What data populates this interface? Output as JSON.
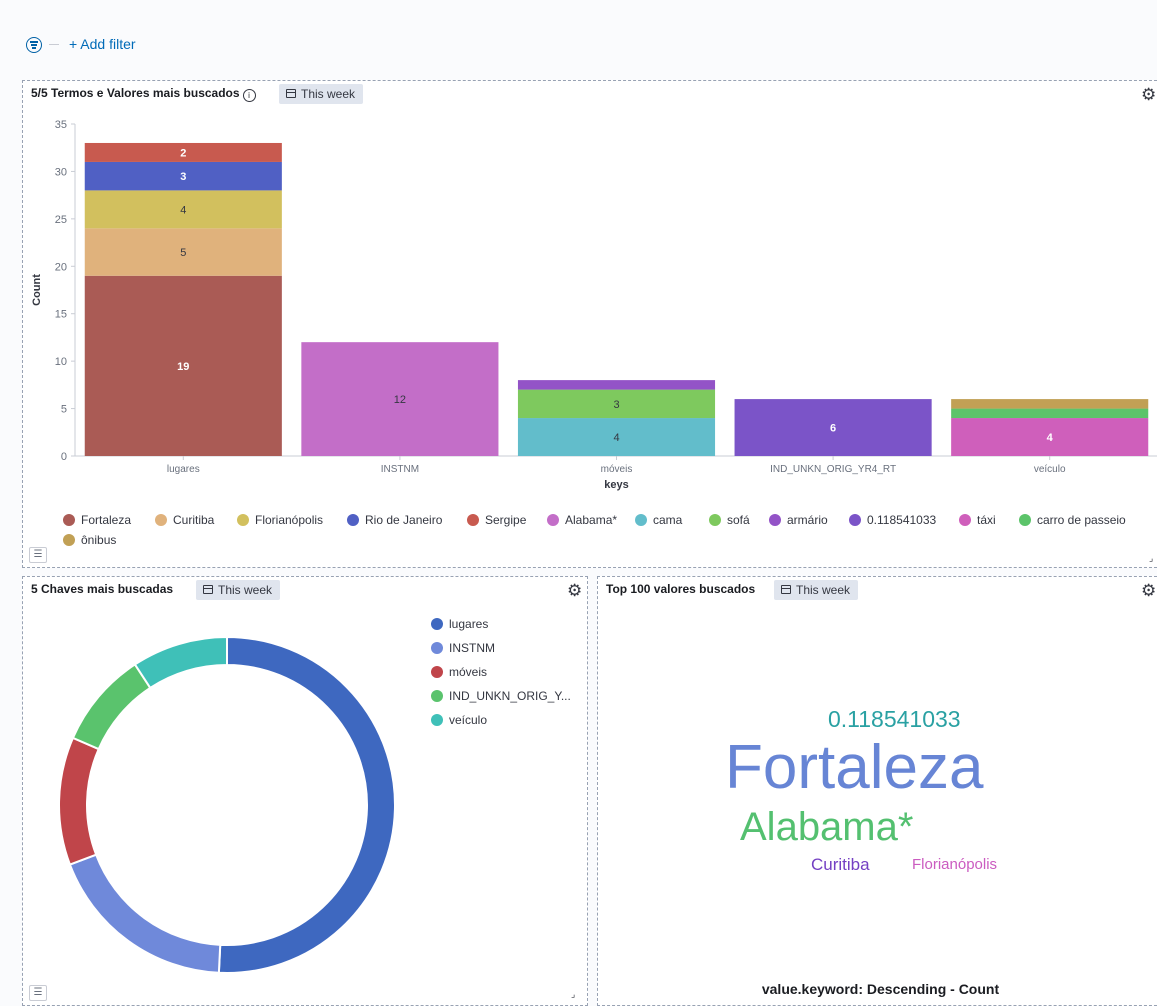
{
  "toolbar": {
    "add_filter": "+ Add filter"
  },
  "panel1": {
    "title": "5/5 Termos e Valores mais buscados",
    "badge": "This week",
    "legend": [
      {
        "label": "Fortaleza",
        "color": "#aa5b55"
      },
      {
        "label": "Curitiba",
        "color": "#e0b27c"
      },
      {
        "label": "Florianópolis",
        "color": "#d2c05e"
      },
      {
        "label": "Rio de Janeiro",
        "color": "#5060c4"
      },
      {
        "label": "Sergipe",
        "color": "#c85a4f"
      },
      {
        "label": "Alabama*",
        "color": "#c36ec8"
      },
      {
        "label": "cama",
        "color": "#62bdcb"
      },
      {
        "label": "sofá",
        "color": "#7ec95e"
      },
      {
        "label": "armário",
        "color": "#9353c7"
      },
      {
        "label": "0.118541033",
        "color": "#7b54c8"
      },
      {
        "label": "táxi",
        "color": "#cf5fbb"
      },
      {
        "label": "carro de passeio",
        "color": "#5cc46a"
      },
      {
        "label": "ônibus",
        "color": "#c1a055"
      }
    ]
  },
  "panel2": {
    "title": "5 Chaves mais buscadas",
    "badge": "This week",
    "legend": [
      {
        "label": "lugares",
        "color": "#3e68c0"
      },
      {
        "label": "INSTNM",
        "color": "#6f89da"
      },
      {
        "label": "móveis",
        "color": "#c0454a"
      },
      {
        "label": "IND_UNKN_ORIG_Y...",
        "color": "#5ac36d"
      },
      {
        "label": "veículo",
        "color": "#3fc0b8"
      }
    ]
  },
  "panel3": {
    "title": "Top 100 valores buscados",
    "badge": "This week",
    "words": [
      {
        "text": "0.118541033",
        "color": "#2aa1a3"
      },
      {
        "text": "Fortaleza",
        "color": "#6785d5"
      },
      {
        "text": "Alabama*",
        "color": "#54c070"
      },
      {
        "text": "Curitiba",
        "color": "#7440c3"
      },
      {
        "text": "Florianópolis",
        "color": "#cb5cc0"
      }
    ],
    "caption": "value.keyword: Descending - Count"
  },
  "chart_data": [
    {
      "type": "bar",
      "stacked": true,
      "categories": [
        "lugares",
        "INSTNM",
        "móveis",
        "IND_UNKN_ORIG_YR4_RT",
        "veículo"
      ],
      "xlabel": "keys",
      "ylabel": "Count",
      "ylim": [
        0,
        35
      ],
      "yticks": [
        0,
        5,
        10,
        15,
        20,
        25,
        30,
        35
      ],
      "series": [
        {
          "name": "Fortaleza",
          "color": "#aa5b55",
          "values": [
            19,
            0,
            0,
            0,
            0
          ]
        },
        {
          "name": "Curitiba",
          "color": "#e0b27c",
          "values": [
            5,
            0,
            0,
            0,
            0
          ]
        },
        {
          "name": "Florianópolis",
          "color": "#d2c05e",
          "values": [
            4,
            0,
            0,
            0,
            0
          ]
        },
        {
          "name": "Rio de Janeiro",
          "color": "#5060c4",
          "values": [
            3,
            0,
            0,
            0,
            0
          ]
        },
        {
          "name": "Sergipe",
          "color": "#c85a4f",
          "values": [
            2,
            0,
            0,
            0,
            0
          ]
        },
        {
          "name": "Alabama*",
          "color": "#c36ec8",
          "values": [
            0,
            12,
            0,
            0,
            0
          ]
        },
        {
          "name": "cama",
          "color": "#62bdcb",
          "values": [
            0,
            0,
            4,
            0,
            0
          ]
        },
        {
          "name": "sofá",
          "color": "#7ec95e",
          "values": [
            0,
            0,
            3,
            0,
            0
          ]
        },
        {
          "name": "armário",
          "color": "#9353c7",
          "values": [
            0,
            0,
            1,
            0,
            0
          ]
        },
        {
          "name": "0.118541033",
          "color": "#7b54c8",
          "values": [
            0,
            0,
            0,
            6,
            0
          ]
        },
        {
          "name": "táxi",
          "color": "#cf5fbb",
          "values": [
            0,
            0,
            0,
            0,
            4
          ]
        },
        {
          "name": "carro de passeio",
          "color": "#5cc46a",
          "values": [
            0,
            0,
            0,
            0,
            1
          ]
        },
        {
          "name": "ônibus",
          "color": "#c1a055",
          "values": [
            0,
            0,
            0,
            0,
            1
          ]
        }
      ],
      "data_labels": [
        {
          "category": "lugares",
          "series": "Fortaleza",
          "value": 19
        },
        {
          "category": "lugares",
          "series": "Curitiba",
          "value": 5
        },
        {
          "category": "lugares",
          "series": "Florianópolis",
          "value": 4
        },
        {
          "category": "lugares",
          "series": "Rio de Janeiro",
          "value": 3
        },
        {
          "category": "lugares",
          "series": "Sergipe",
          "value": 2
        },
        {
          "category": "INSTNM",
          "series": "Alabama*",
          "value": 12
        },
        {
          "category": "móveis",
          "series": "cama",
          "value": 4
        },
        {
          "category": "móveis",
          "series": "sofá",
          "value": 3
        },
        {
          "category": "IND_UNKN_ORIG_YR4_RT",
          "series": "0.118541033",
          "value": 6
        },
        {
          "category": "veículo",
          "series": "táxi",
          "value": 4
        }
      ]
    },
    {
      "type": "pie",
      "donut": true,
      "categories": [
        "lugares",
        "INSTNM",
        "móveis",
        "IND_UNKN_ORIG_YR4_RT",
        "veículo"
      ],
      "values": [
        33,
        12,
        8,
        6,
        6
      ],
      "colors": [
        "#3e68c0",
        "#6f89da",
        "#c0454a",
        "#5ac36d",
        "#3fc0b8"
      ],
      "legend_position": "top-right"
    }
  ]
}
